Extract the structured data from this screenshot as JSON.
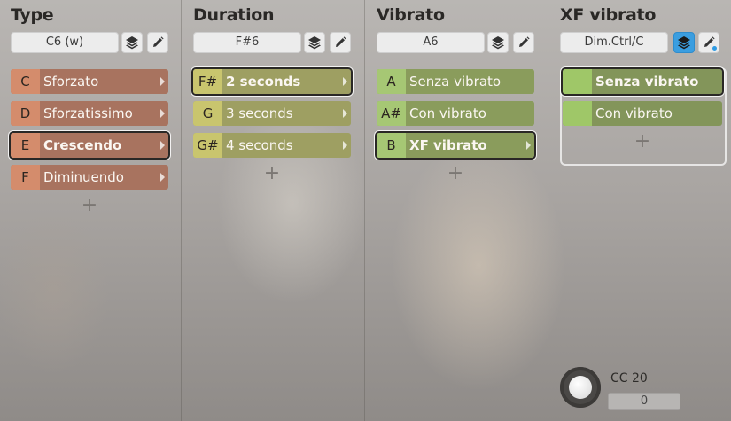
{
  "columns": [
    {
      "title": "Type",
      "selector": "C6 (w)",
      "rows": [
        {
          "key": "C",
          "label": "Sforzato"
        },
        {
          "key": "D",
          "label": "Sforzatissimo"
        },
        {
          "key": "E",
          "label": "Crescendo",
          "selected": true
        },
        {
          "key": "F",
          "label": "Diminuendo"
        }
      ],
      "add": "+"
    },
    {
      "title": "Duration",
      "selector": "F#6",
      "rows": [
        {
          "key": "F#",
          "label": "2 seconds",
          "selected": true
        },
        {
          "key": "G",
          "label": "3 seconds"
        },
        {
          "key": "G#",
          "label": "4 seconds"
        }
      ],
      "add": "+"
    },
    {
      "title": "Vibrato",
      "selector": "A6",
      "rows": [
        {
          "key": "A",
          "label": "Senza vibrato"
        },
        {
          "key": "A#",
          "label": "Con vibrato"
        },
        {
          "key": "B",
          "label": "XF vibrato",
          "selected": true
        }
      ],
      "add": "+"
    },
    {
      "title": "XF vibrato",
      "selector": "Dim.Ctrl/C",
      "rows": [
        {
          "label": "Senza vibrato",
          "selected": true
        },
        {
          "label": "Con vibrato"
        }
      ],
      "add": "+"
    }
  ],
  "icons": {
    "layers": "layers-icon",
    "edit": "pencil-icon"
  },
  "controller": {
    "label": "CC 20",
    "value": "0"
  },
  "colors": {
    "type_row": "#a8735f",
    "duration_row": "#9e9f62",
    "vibrato_row": "#8a9c5c",
    "active_button": "#3b9ee0"
  }
}
